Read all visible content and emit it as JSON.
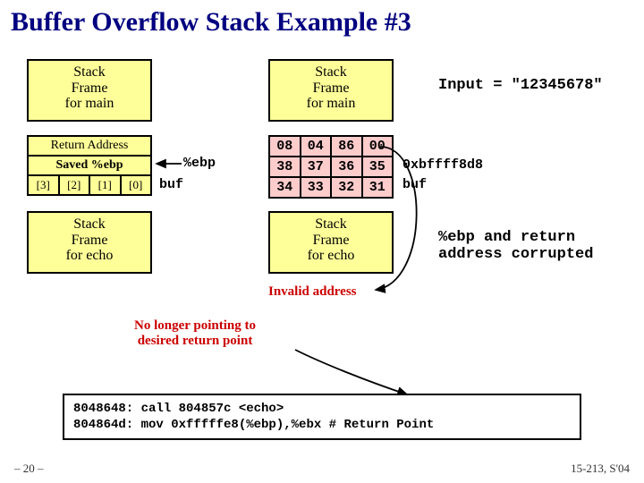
{
  "title": "Buffer Overflow Stack Example #3",
  "left": {
    "main": "Stack\nFrame\nfor main",
    "ret": "Return Address",
    "saved": "Saved %ebp",
    "buf": [
      "[3]",
      "[2]",
      "[1]",
      "[0]"
    ],
    "echo": "Stack\nFrame\nfor echo",
    "ebp_label": "%ebp",
    "buf_label": "buf"
  },
  "right": {
    "main": "Stack\nFrame\nfor main",
    "row1": [
      "08",
      "04",
      "86",
      "00"
    ],
    "row2": [
      "38",
      "37",
      "36",
      "35"
    ],
    "row3": [
      "34",
      "33",
      "32",
      "31"
    ],
    "echo": "Stack\nFrame\nfor echo",
    "lab1": "0xbffff8d8",
    "lab2": "buf"
  },
  "input_label": "Input = \"12345678\"",
  "corrupt_label": "%ebp and return\naddress corrupted",
  "invalid": "Invalid address",
  "nolonger": "No longer pointing to\ndesired return point",
  "code_line1": "8048648:  call 804857c <echo>",
  "code_line2": "804864d:  mov  0xfffffe8(%ebp),%ebx # Return Point",
  "footer_left": "– 20 –",
  "footer_right": "15-213, S'04"
}
